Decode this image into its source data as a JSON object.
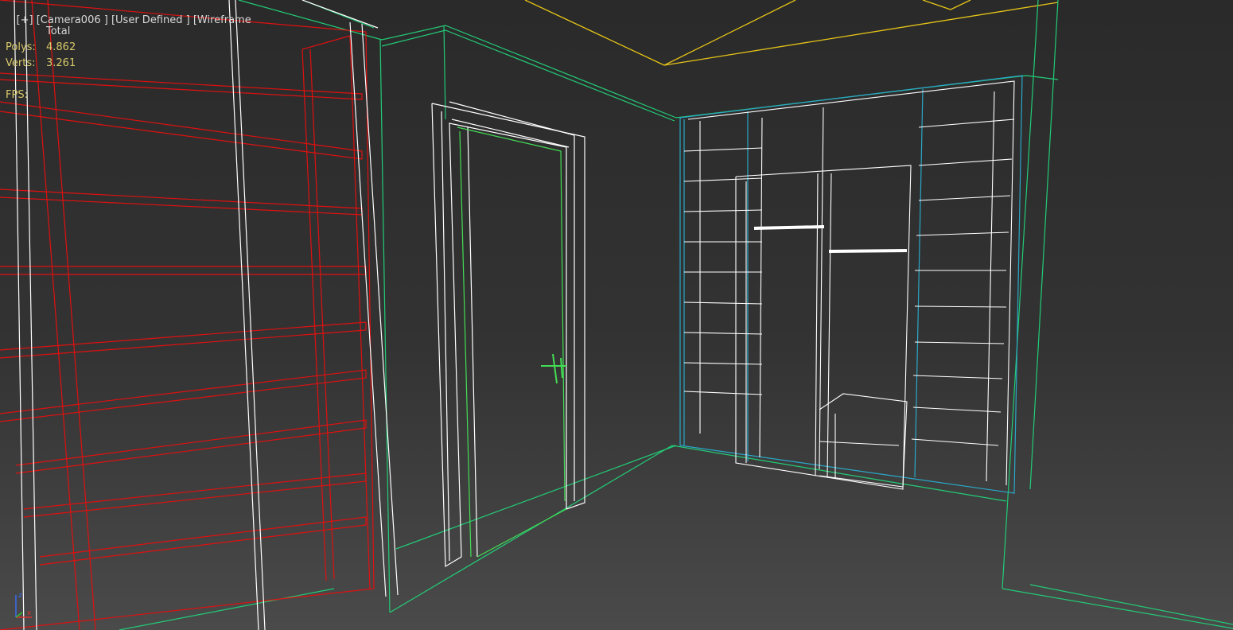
{
  "viewport": {
    "label_parts": [
      "[+]",
      "[Camera006 ]",
      "[User Defined ]",
      "[Wireframe"
    ],
    "stats": {
      "header": "Total",
      "rows": [
        {
          "label": "Polys:",
          "value": "4.862"
        },
        {
          "label": "Verts:",
          "value": "3.261"
        }
      ],
      "fps_label": "FPS:"
    },
    "axis_labels": {
      "z": "z",
      "x": "x"
    }
  },
  "colors": {
    "background": "#333333",
    "wire_red": "#e01010",
    "wire_white": "#ffffff",
    "wire_green": "#22cc77",
    "wire_yellow": "#e6c417",
    "wire_cyan": "#2aa8c8",
    "stats_text": "#d8c96a"
  }
}
